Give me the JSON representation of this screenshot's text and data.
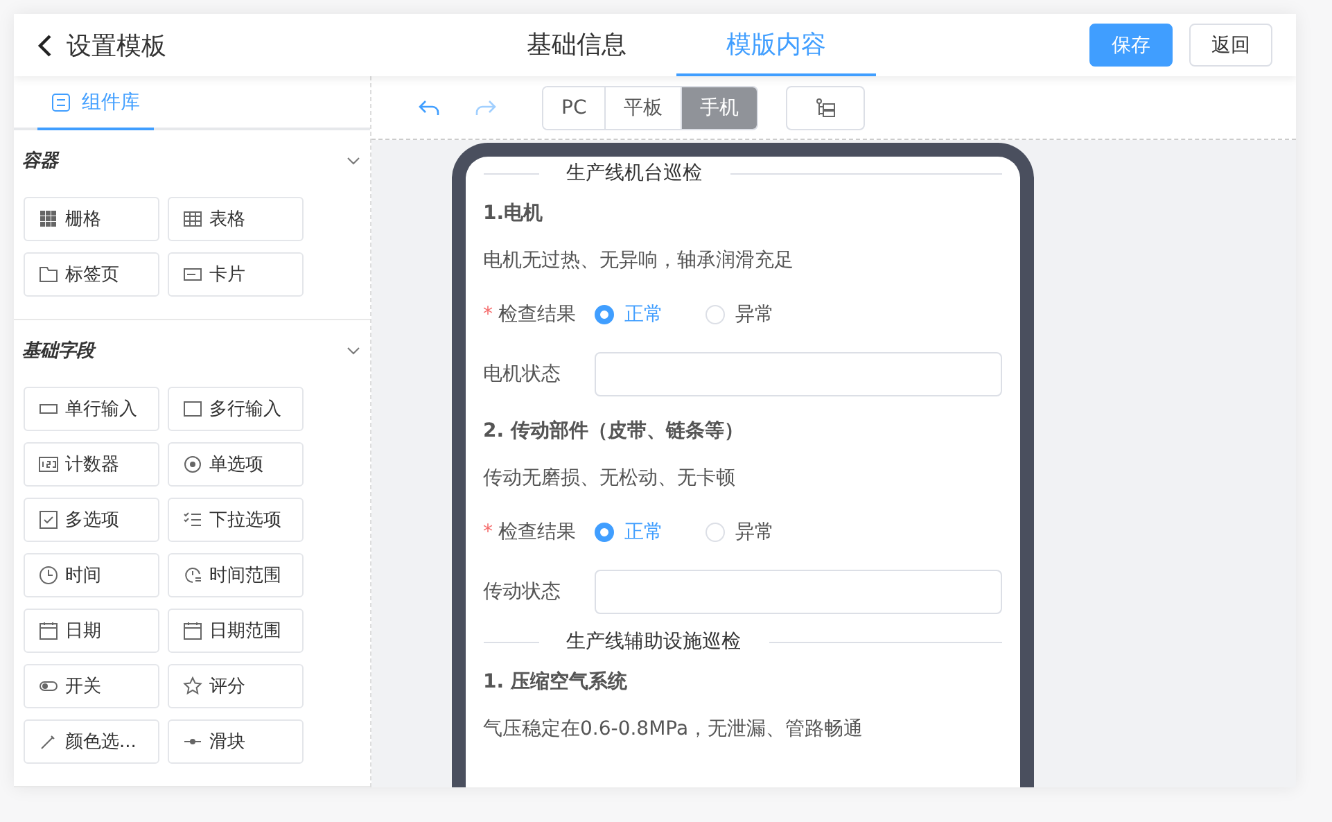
{
  "header": {
    "title": "设置模板",
    "tabs": [
      {
        "label": "基础信息",
        "selected": false
      },
      {
        "label": "模版内容",
        "selected": true
      }
    ],
    "buttons": [
      {
        "label": "保存",
        "kind": "primary"
      },
      {
        "label": "返回",
        "kind": "plain"
      }
    ]
  },
  "sidebar": {
    "tab": {
      "label": "组件库",
      "selected": true
    },
    "groups": [
      {
        "title": "容器",
        "expanded": true,
        "items": [
          {
            "label": "栅格",
            "kind": "grid"
          },
          {
            "label": "表格",
            "kind": "table"
          },
          {
            "label": "标签页",
            "kind": "folder"
          },
          {
            "label": "卡片",
            "kind": "card"
          }
        ]
      },
      {
        "title": "基础字段",
        "expanded": true,
        "items": [
          {
            "label": "单行输入",
            "kind": "input"
          },
          {
            "label": "多行输入",
            "kind": "textarea"
          },
          {
            "label": "计数器",
            "kind": "number"
          },
          {
            "label": "单选项",
            "kind": "radio"
          },
          {
            "label": "多选项",
            "kind": "checkbox"
          },
          {
            "label": "下拉选项",
            "kind": "list"
          },
          {
            "label": "时间",
            "kind": "clock"
          },
          {
            "label": "时间范围",
            "kind": "clockrange"
          },
          {
            "label": "日期",
            "kind": "calendar"
          },
          {
            "label": "日期范围",
            "kind": "calendar"
          },
          {
            "label": "开关",
            "kind": "switch"
          },
          {
            "label": "评分",
            "kind": "star"
          },
          {
            "label": "颜色选...",
            "kind": "picker"
          },
          {
            "label": "滑块",
            "kind": "slider"
          }
        ]
      }
    ]
  },
  "toolbar": {
    "devices": [
      {
        "label": "PC",
        "selected": false
      },
      {
        "label": "平板",
        "selected": false
      },
      {
        "label": "手机",
        "selected": true
      }
    ]
  },
  "form": [
    {
      "kind": "divider",
      "text": "生产线机台巡检"
    },
    {
      "kind": "heading",
      "text": "1.电机"
    },
    {
      "kind": "description",
      "text": "电机无过热、无异响，轴承润滑充足"
    },
    {
      "kind": "radio",
      "label": "检查结果",
      "required_mark": "*",
      "options": [
        {
          "label": "正常",
          "selected": true
        },
        {
          "label": "异常",
          "selected": false
        }
      ]
    },
    {
      "kind": "input",
      "label": "电机状态"
    },
    {
      "kind": "heading",
      "text": "2. 传动部件（皮带、链条等）"
    },
    {
      "kind": "description",
      "text": "传动无磨损、无松动、无卡顿"
    },
    {
      "kind": "radio",
      "label": "检查结果",
      "required_mark": "*",
      "options": [
        {
          "label": "正常",
          "selected": true
        },
        {
          "label": "异常",
          "selected": false
        }
      ]
    },
    {
      "kind": "input",
      "label": "传动状态"
    },
    {
      "kind": "divider",
      "text": "生产线辅助设施巡检"
    },
    {
      "kind": "heading",
      "text": "1. 压缩空气系统"
    },
    {
      "kind": "description",
      "text": "气压稳定在0.6-0.8MPa，无泄漏、管路畅通"
    }
  ]
}
